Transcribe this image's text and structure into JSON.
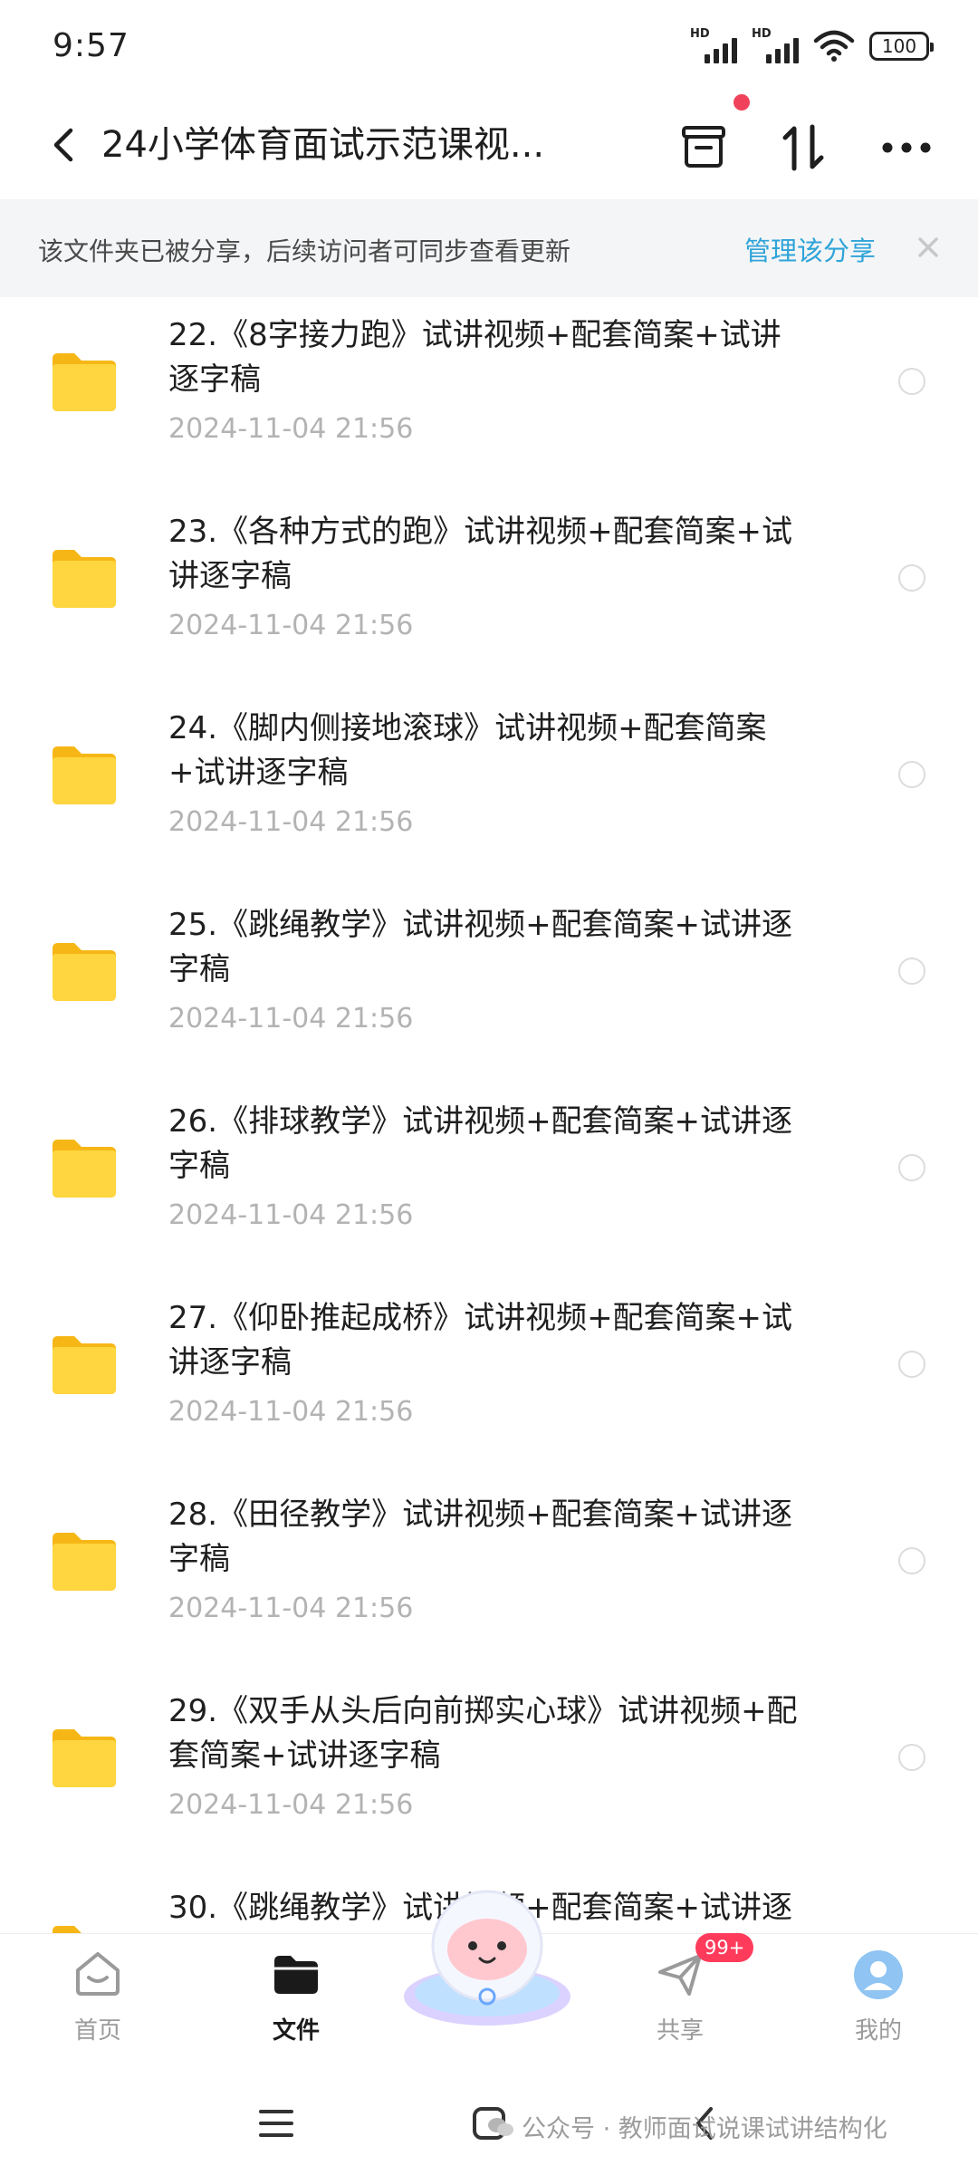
{
  "status_bar": {
    "time": "9:57",
    "hd1": "HD",
    "hd2": "HD",
    "battery": "100"
  },
  "header": {
    "title": "24小学体育面试示范课视..."
  },
  "banner": {
    "text": "该文件夹已被分享，后续访问者可同步查看更新",
    "link": "管理该分享"
  },
  "files": [
    {
      "line1": "22.《8字接力跑》试讲视频+配套简案+试讲",
      "line2": "逐字稿",
      "date": "2024-11-04  21:56"
    },
    {
      "line1": "23.《各种方式的跑》试讲视频+配套简案+试",
      "line2": "讲逐字稿",
      "date": "2024-11-04  21:56"
    },
    {
      "line1": "24.《脚内侧接地滚球》试讲视频+配套简案",
      "line2": "+试讲逐字稿",
      "date": "2024-11-04  21:56"
    },
    {
      "line1": "25.《跳绳教学》试讲视频+配套简案+试讲逐",
      "line2": "字稿",
      "date": "2024-11-04  21:56"
    },
    {
      "line1": "26.《排球教学》试讲视频+配套简案+试讲逐",
      "line2": "字稿",
      "date": "2024-11-04  21:56"
    },
    {
      "line1": "27.《仰卧推起成桥》试讲视频+配套简案+试",
      "line2": "讲逐字稿",
      "date": "2024-11-04  21:56"
    },
    {
      "line1": "28.《田径教学》试讲视频+配套简案+试讲逐",
      "line2": "字稿",
      "date": "2024-11-04  21:56"
    },
    {
      "line1": "29.《双手从头后向前掷实心球》试讲视频+配",
      "line2": "套简案+试讲逐字稿",
      "date": "2024-11-04  21:56"
    },
    {
      "line1": "30.《跳绳教学》试讲视频+配套简案+试讲逐",
      "line2": "",
      "date": ""
    }
  ],
  "bottom_nav": {
    "home": "首页",
    "files": "文件",
    "share": "共享",
    "share_badge": "99+",
    "mine": "我的"
  },
  "watermark": "公众号 · 教师面试说课试讲结构化",
  "colors": {
    "accent": "#2fa4d8",
    "folder": "#ffd23f",
    "badge": "#ff3b5c",
    "dot": "#f0435b"
  }
}
